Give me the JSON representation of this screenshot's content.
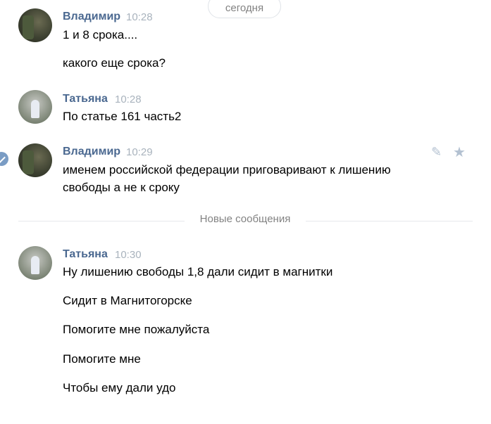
{
  "date_label": "сегодня",
  "new_messages_label": "Новые сообщения",
  "messages": [
    {
      "author": "Владимир",
      "time": "10:28",
      "lines": [
        "1 и 8 срока....",
        "какого еще срока?"
      ]
    },
    {
      "author": "Татьяна",
      "time": "10:28",
      "lines": [
        "По статье 161 часть2"
      ]
    },
    {
      "author": "Владимир",
      "time": "10:29",
      "lines": [
        "именем российской федерации приговаривают к лишению",
        "свободы а не к сроку"
      ]
    },
    {
      "author": "Татьяна",
      "time": "10:30",
      "lines": [
        "Ну лишению свободы 1,8 дали сидит в магнитки",
        "Сидит в Магнитогорске",
        "Помогите мне пожалуйста",
        "Помогите мне",
        "Чтобы ему дали удо"
      ]
    }
  ],
  "icons": {
    "edit": "pencil-icon",
    "favorite": "star-icon",
    "selected": "check-icon"
  }
}
